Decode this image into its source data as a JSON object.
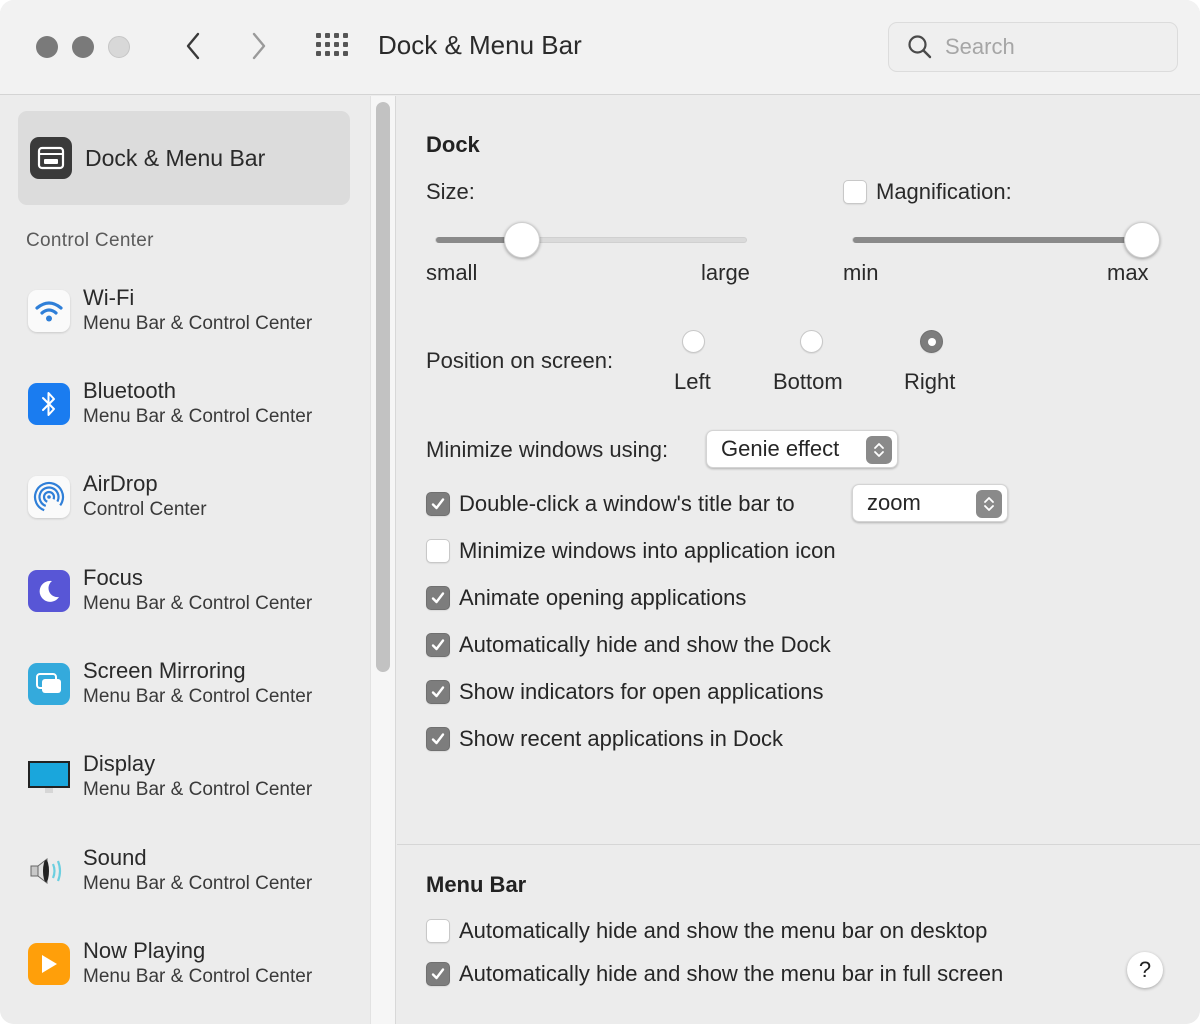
{
  "window": {
    "title": "Dock & Menu Bar",
    "search_placeholder": "Search",
    "search_value": ""
  },
  "sidebar": {
    "selected": {
      "label": "Dock & Menu Bar",
      "icon": "dock-menubar-icon"
    },
    "section_label": "Control Center",
    "items": [
      {
        "name": "Wi-Fi",
        "sub": "Menu Bar & Control Center",
        "icon": "wifi-icon"
      },
      {
        "name": "Bluetooth",
        "sub": "Menu Bar & Control Center",
        "icon": "bluetooth-icon"
      },
      {
        "name": "AirDrop",
        "sub": "Control Center",
        "icon": "airdrop-icon"
      },
      {
        "name": "Focus",
        "sub": "Menu Bar & Control Center",
        "icon": "moon-icon"
      },
      {
        "name": "Screen Mirroring",
        "sub": "Menu Bar & Control Center",
        "icon": "screen-mirroring-icon"
      },
      {
        "name": "Display",
        "sub": "Menu Bar & Control Center",
        "icon": "display-icon"
      },
      {
        "name": "Sound",
        "sub": "Menu Bar & Control Center",
        "icon": "speaker-icon"
      },
      {
        "name": "Now Playing",
        "sub": "Menu Bar & Control Center",
        "icon": "play-icon"
      }
    ]
  },
  "dock": {
    "heading": "Dock",
    "size": {
      "label": "Size:",
      "min_label": "small",
      "max_label": "large",
      "value_fraction": 0.28
    },
    "magnification": {
      "label": "Magnification:",
      "checked": false,
      "min_label": "min",
      "max_label": "max",
      "value_fraction": 1.0
    },
    "position": {
      "label": "Position on screen:",
      "options": [
        "Left",
        "Bottom",
        "Right"
      ],
      "selected": "Right"
    },
    "minimize_using": {
      "label": "Minimize windows using:",
      "value": "Genie effect"
    },
    "double_click": {
      "label": "Double-click a window's title bar to",
      "checked": true,
      "value": "zoom"
    },
    "checkboxes": [
      {
        "label": "Minimize windows into application icon",
        "checked": false
      },
      {
        "label": "Animate opening applications",
        "checked": true
      },
      {
        "label": "Automatically hide and show the Dock",
        "checked": true
      },
      {
        "label": "Show indicators for open applications",
        "checked": true
      },
      {
        "label": "Show recent applications in Dock",
        "checked": true
      }
    ]
  },
  "menu_bar": {
    "heading": "Menu Bar",
    "checkboxes": [
      {
        "label": "Automatically hide and show the menu bar on desktop",
        "checked": false
      },
      {
        "label": "Automatically hide and show the menu bar in full screen",
        "checked": true
      }
    ]
  },
  "help_label": "?",
  "colors": {
    "wifi": "#2f7fd8",
    "bluetooth": "#1a7cf0",
    "focus": "#5856d6",
    "screen_mirroring": "#34aadc",
    "display": "#1aa6dc",
    "now_playing": "#ff9f0a",
    "control_gray": "#7d7d7d"
  }
}
